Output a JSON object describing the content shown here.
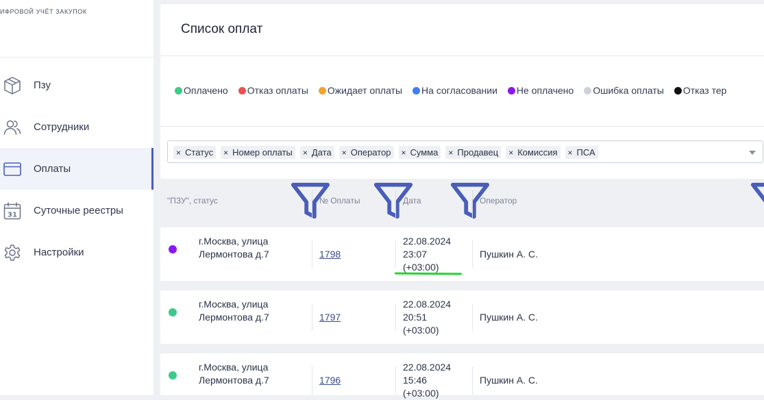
{
  "brand": {
    "text": "ИФРОВОЙ УЧЁТ ЗАКУПОК"
  },
  "sidebar": {
    "items": [
      {
        "label": "Пзу",
        "icon": "box-icon"
      },
      {
        "label": "Сотрудники",
        "icon": "users-icon"
      },
      {
        "label": "Оплаты",
        "icon": "card-icon",
        "active": true
      },
      {
        "label": "Суточные реестры",
        "icon": "calendar-icon"
      },
      {
        "label": "Настройки",
        "icon": "gear-icon"
      }
    ],
    "calendar_day": "31"
  },
  "header": {
    "title": "Список оплат"
  },
  "legend": [
    {
      "label": "Оплачено",
      "color": "#3dc98a"
    },
    {
      "label": "Отказ оплаты",
      "color": "#ef4f4f"
    },
    {
      "label": "Ожидает оплаты",
      "color": "#f2a428"
    },
    {
      "label": "На согласовании",
      "color": "#3f7ff0"
    },
    {
      "label": "Не оплачено",
      "color": "#8a17f0"
    },
    {
      "label": "Ошибка оплаты",
      "color": "#cfd2d8"
    },
    {
      "label": "Отказ тер",
      "color": "#111111"
    }
  ],
  "filters": {
    "chips": [
      "Статус",
      "Номер оплаты",
      "Дата",
      "Оператор",
      "Сумма",
      "Продавец",
      "Комиссия",
      "ПСА"
    ],
    "remove_glyph": "×"
  },
  "table": {
    "columns": [
      "\"ПЗУ\", статус",
      "№ Оплаты",
      "Дата",
      "Оператор"
    ],
    "rows": [
      {
        "status_color": "#8a17f0",
        "address1": "г.Москва, улица",
        "address2": "Лермонтова д.7",
        "number": "1798",
        "date": "22.08.2024",
        "time": "23:07",
        "tz": "(+03:00)",
        "operator": "Пушкин А. С."
      },
      {
        "status_color": "#3dc98a",
        "address1": "г.Москва, улица",
        "address2": "Лермонтова д.7",
        "number": "1797",
        "date": "22.08.2024",
        "time": "20:51",
        "tz": "(+03:00)",
        "operator": "Пушкин А. С."
      },
      {
        "status_color": "#3dc98a",
        "address1": "г.Москва, улица",
        "address2": "Лермонтова д.7",
        "number": "1796",
        "date": "22.08.2024",
        "time": "15:46",
        "tz": "(+03:00)",
        "operator": "Пушкин А. С."
      }
    ]
  }
}
